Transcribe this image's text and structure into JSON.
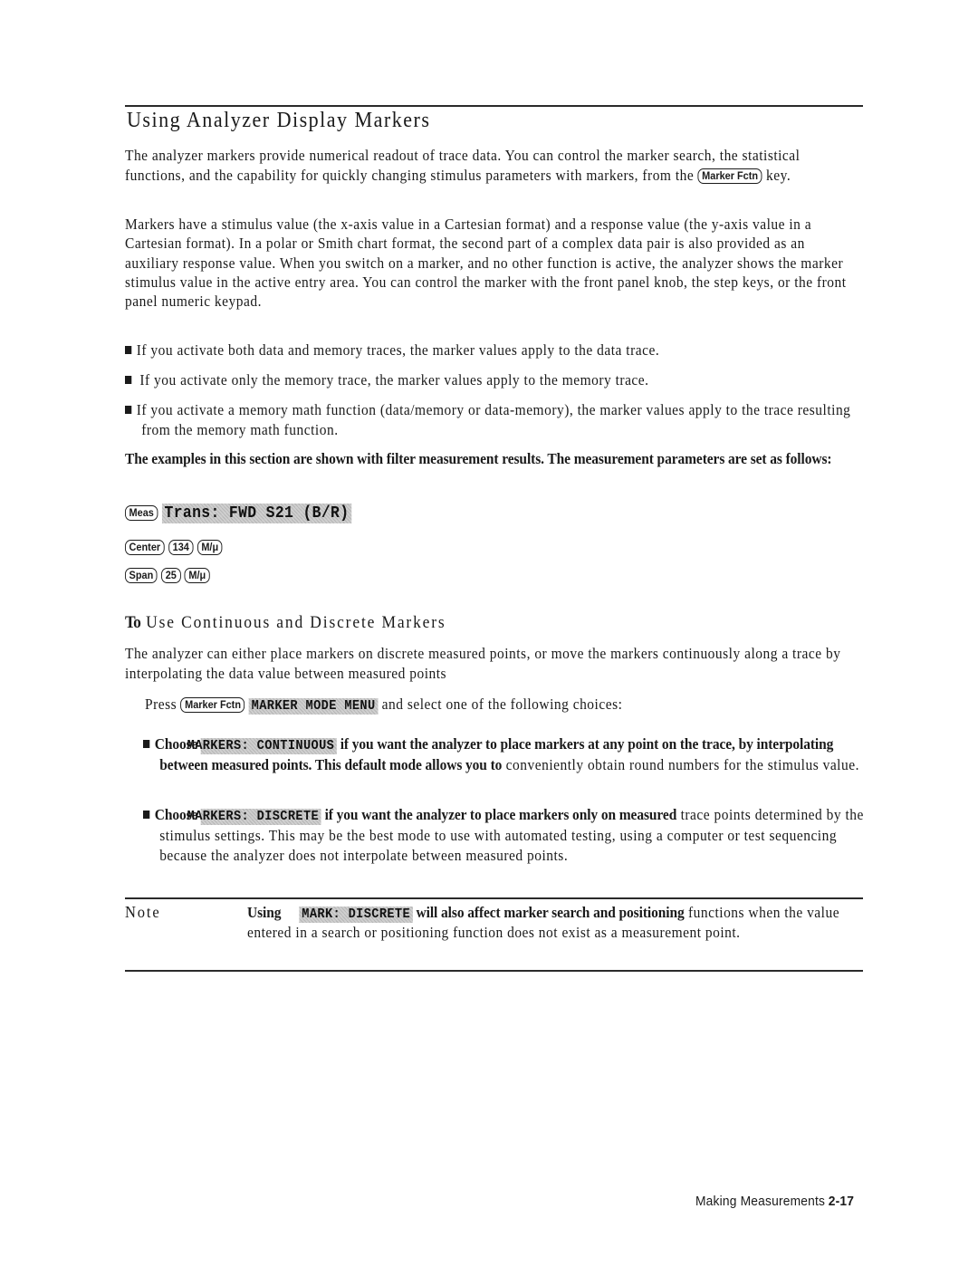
{
  "section": {
    "title": "Using Analyzer Display Markers",
    "intro": {
      "before_key": "The analyzer markers provide numerical readout of trace data. You can control the marker search, the statistical functions, and the capability for quickly changing stimulus parameters with markers, from the ",
      "key": "Marker Fctn",
      "after_key": " key."
    },
    "paragraph2": "Markers have a stimulus value (the x-axis value in a Cartesian format) and a response value (the y-axis value in a Cartesian format). In a polar or Smith chart format, the second part of a complex data pair is also provided as an auxiliary response value. When you switch on a marker, and no other function is active, the analyzer shows the marker stimulus value in the active entry area. You can control the marker with the front panel knob, the step keys, or the front panel numeric keypad.",
    "bullets": [
      "If you activate both data and memory traces, the marker values apply to the data trace.",
      "If you activate only the memory trace, the marker values apply to the memory trace.",
      "If you activate a memory math function (data/memory or data-memory), the marker values apply to the trace resulting from the memory math function."
    ],
    "examples_intro": "The examples in this section are shown with filter measurement results. The measurement parameters are set as follows:",
    "key_sequences": [
      {
        "keys": [
          "Meas"
        ],
        "softkey": "Trans: FWD S21 (B/R)"
      },
      {
        "keys": [
          "Center",
          "134",
          "M/μ"
        ]
      },
      {
        "keys": [
          "Span",
          "25",
          "M/μ"
        ]
      }
    ]
  },
  "subsection": {
    "title_prefix": "To",
    "title_rest": " Use Continuous and Discrete Markers",
    "intro": "The analyzer can either place markers on discrete measured points, or move the markers continuously along a trace by interpolating the data value between measured points",
    "press": {
      "prefix": "Press ",
      "key": "Marker Fctn",
      "softkey": "MARKER MODE MENU",
      "suffix": " and select one of the following choices:"
    },
    "choices": [
      {
        "choose": "Choose ",
        "softkey": "MARKERS: CONTINUOUS",
        "bold_text": " if you want the analyzer to place markers at any point on the trace, by interpolating between measured points. This default mode allows you to",
        "normal_text": " conveniently obtain round numbers for the stimulus value."
      },
      {
        "choose": "Choose ",
        "softkey": "MARKERS: DISCRETE",
        "bold_text": " if you want the analyzer to place markers only on measured",
        "normal_text": " trace points determined by the stimulus settings. This may be the best mode to use with automated testing, using a computer or test sequencing because the analyzer does not interpolate between measured points."
      }
    ]
  },
  "note": {
    "label": "Note",
    "using": "Using ",
    "softkey": "MARK: DISCRETE",
    "bold_text": " will also affect marker search and positioning",
    "normal_text": " functions when the value entered in a search or positioning function does not exist as a measurement point."
  },
  "footer": {
    "chapter": "Making Measurements",
    "page": "2-17"
  }
}
